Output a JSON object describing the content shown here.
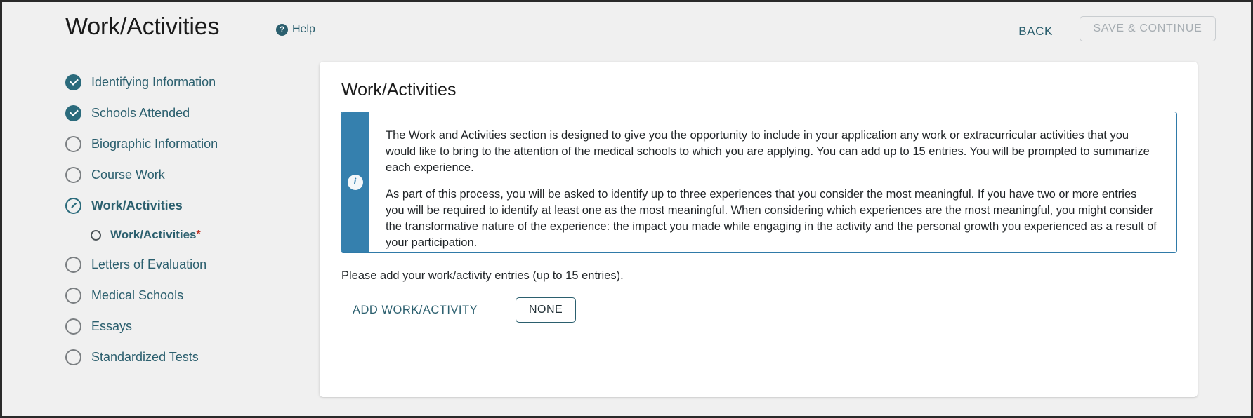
{
  "header": {
    "title": "Work/Activities",
    "help_label": "Help",
    "help_icon": "question-circle-icon",
    "back_label": "BACK",
    "save_label": "SAVE & CONTINUE",
    "accent_color": "#2b5f6e"
  },
  "sidebar": {
    "items": [
      {
        "label": "Identifying Information",
        "state": "done"
      },
      {
        "label": "Schools Attended",
        "state": "done"
      },
      {
        "label": "Biographic Information",
        "state": "todo"
      },
      {
        "label": "Course Work",
        "state": "todo"
      },
      {
        "label": "Work/Activities",
        "state": "current"
      },
      {
        "label": "Work/Activities",
        "state": "sub",
        "required_marker": "*"
      },
      {
        "label": "Letters of Evaluation",
        "state": "todo"
      },
      {
        "label": "Medical Schools",
        "state": "todo"
      },
      {
        "label": "Essays",
        "state": "todo"
      },
      {
        "label": "Standardized Tests",
        "state": "todo"
      }
    ]
  },
  "main": {
    "card_title": "Work/Activities",
    "info": {
      "icon": "info-circle-icon",
      "bar_color": "#3580ae",
      "border_color": "#2f7aa8",
      "paragraph_1": "The Work and Activities section is designed to give you the opportunity to include in your application any work or extracurricular activities that you would like to bring to the attention of the medical schools to which you are applying. You can add up to 15 entries. You will be prompted to summarize each experience.",
      "paragraph_2": "As part of this process, you will be asked to identify up to three experiences that you consider the most meaningful. If you have two or more entries you will be required to identify at least one as the most meaningful. When considering which experiences are the most meaningful, you might consider the transformative nature of the experience: the impact you made while engaging in the activity and the personal growth you experienced as a result of your participation."
    },
    "instruction": "Please add your work/activity entries (up to 15 entries).",
    "add_label": "ADD WORK/ACTIVITY",
    "none_label": "NONE"
  }
}
